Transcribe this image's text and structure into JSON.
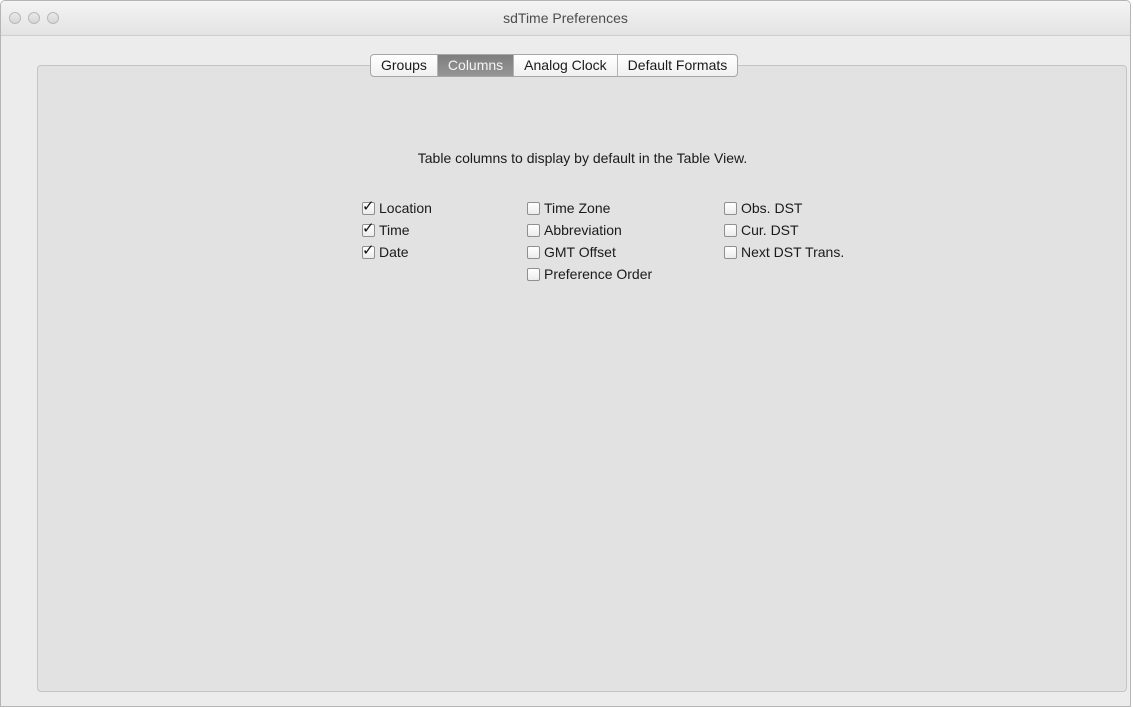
{
  "window": {
    "title": "sdTime Preferences"
  },
  "tabs": [
    {
      "label": "Groups",
      "selected": false
    },
    {
      "label": "Columns",
      "selected": true
    },
    {
      "label": "Analog Clock",
      "selected": false
    },
    {
      "label": "Default Formats",
      "selected": false
    }
  ],
  "columns_panel": {
    "description": "Table columns to display by default in the Table View.",
    "checkbox_columns": [
      [
        {
          "label": "Location",
          "checked": true
        },
        {
          "label": "Time",
          "checked": true
        },
        {
          "label": "Date",
          "checked": true
        }
      ],
      [
        {
          "label": "Time Zone",
          "checked": false
        },
        {
          "label": "Abbreviation",
          "checked": false
        },
        {
          "label": "GMT Offset",
          "checked": false
        },
        {
          "label": "Preference Order",
          "checked": false
        }
      ],
      [
        {
          "label": "Obs. DST",
          "checked": false
        },
        {
          "label": "Cur. DST",
          "checked": false
        },
        {
          "label": "Next DST Trans.",
          "checked": false
        }
      ]
    ],
    "check_glyph": "✓"
  },
  "colors": {
    "selected_tab": "#868686",
    "panel_background": "#e2e2e2",
    "window_background": "#ececec"
  }
}
